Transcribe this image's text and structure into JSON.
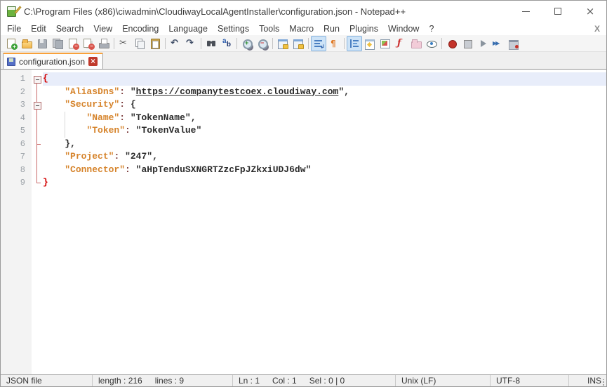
{
  "window": {
    "title": "C:\\Program Files (x86)\\ciwadmin\\CloudiwayLocalAgentInstaller\\configuration.json - Notepad++",
    "app_icon": "notepad-plus-plus-icon",
    "controls": [
      "minimize-icon",
      "maximize-icon",
      "close-icon"
    ]
  },
  "menu": {
    "items": [
      "File",
      "Edit",
      "Search",
      "View",
      "Encoding",
      "Language",
      "Settings",
      "Tools",
      "Macro",
      "Run",
      "Plugins",
      "Window",
      "?"
    ],
    "close_document_x": "X"
  },
  "toolbar": {
    "items": [
      {
        "name": "new-file"
      },
      {
        "name": "open"
      },
      {
        "name": "save"
      },
      {
        "name": "save-all"
      },
      {
        "name": "close"
      },
      {
        "name": "close-all"
      },
      {
        "name": "print"
      },
      {
        "sep": true
      },
      {
        "name": "cut"
      },
      {
        "name": "copy"
      },
      {
        "name": "paste"
      },
      {
        "sep": true
      },
      {
        "name": "undo"
      },
      {
        "name": "redo"
      },
      {
        "sep": true
      },
      {
        "name": "find"
      },
      {
        "name": "replace"
      },
      {
        "sep": true
      },
      {
        "name": "zoom-in"
      },
      {
        "name": "zoom-out"
      },
      {
        "sep": true
      },
      {
        "name": "sync-v"
      },
      {
        "name": "sync-h"
      },
      {
        "sep": true
      },
      {
        "name": "word-wrap",
        "pressed": true
      },
      {
        "name": "show-all-chars"
      },
      {
        "sep": true
      },
      {
        "name": "indent-guide",
        "pressed": true
      },
      {
        "name": "doc-switcher"
      },
      {
        "name": "doc-map"
      },
      {
        "name": "function-list"
      },
      {
        "name": "folder-as-workspace"
      },
      {
        "name": "monitoring"
      },
      {
        "sep": true
      },
      {
        "name": "macro-record"
      },
      {
        "name": "macro-stop"
      },
      {
        "name": "macro-play"
      },
      {
        "name": "macro-run-multiple"
      },
      {
        "name": "macro-save"
      }
    ]
  },
  "tabs": [
    {
      "label": "configuration.json",
      "saved": true
    }
  ],
  "editor": {
    "lines": [
      {
        "n": 1,
        "fold": "boxfirst",
        "cur": true,
        "toks": [
          [
            "{",
            "brace"
          ]
        ]
      },
      {
        "n": 2,
        "fold": "v",
        "toks": [
          [
            "    ",
            "pln"
          ],
          [
            "\"AliasDns\"",
            "key"
          ],
          [
            ":",
            "op"
          ],
          [
            " ",
            "pln"
          ],
          [
            "\"",
            "str"
          ],
          [
            "https://companytestcoex.cloudiway.com",
            "url"
          ],
          [
            "\"",
            "str"
          ],
          [
            ",",
            "pln"
          ]
        ]
      },
      {
        "n": 3,
        "fold": "box",
        "toks": [
          [
            "    ",
            "pln"
          ],
          [
            "\"Security\"",
            "key"
          ],
          [
            ":",
            "op"
          ],
          [
            " {",
            "pln"
          ]
        ]
      },
      {
        "n": 4,
        "fold": "v",
        "guide": true,
        "toks": [
          [
            "        ",
            "pln"
          ],
          [
            "\"Name\"",
            "key"
          ],
          [
            ":",
            "op"
          ],
          [
            " ",
            "pln"
          ],
          [
            "\"TokenName\"",
            "str"
          ],
          [
            ",",
            "pln"
          ]
        ]
      },
      {
        "n": 5,
        "fold": "v",
        "guide": true,
        "toks": [
          [
            "        ",
            "pln"
          ],
          [
            "\"Token\"",
            "key"
          ],
          [
            ":",
            "op"
          ],
          [
            " ",
            "pln"
          ],
          [
            "\"TokenValue\"",
            "str"
          ]
        ]
      },
      {
        "n": 6,
        "fold": "tee",
        "toks": [
          [
            "    ",
            "pln"
          ],
          [
            "},",
            "pln"
          ]
        ]
      },
      {
        "n": 7,
        "fold": "v",
        "toks": [
          [
            "    ",
            "pln"
          ],
          [
            "\"Project\"",
            "key"
          ],
          [
            ":",
            "op"
          ],
          [
            " ",
            "pln"
          ],
          [
            "\"247\"",
            "str"
          ],
          [
            ",",
            "pln"
          ]
        ]
      },
      {
        "n": 8,
        "fold": "v",
        "toks": [
          [
            "    ",
            "pln"
          ],
          [
            "\"Connector\"",
            "key"
          ],
          [
            ":",
            "op"
          ],
          [
            " ",
            "pln"
          ],
          [
            "\"aHpTenduSXNGRTZzcFpJZkxiUDJ6dw\"",
            "str"
          ]
        ]
      },
      {
        "n": 9,
        "fold": "corner",
        "toks": [
          [
            "}",
            "brace"
          ]
        ]
      }
    ]
  },
  "status": {
    "doctype": "JSON file",
    "length_text": "length : 216",
    "lines_text": "lines : 9",
    "ln": "Ln : 1",
    "col": "Col : 1",
    "sel": "Sel : 0 | 0",
    "eol": "Unix (LF)",
    "encoding": "UTF-8",
    "mode": "INS"
  },
  "colors": {
    "tab_accent_orange": "#f9a13a",
    "json_key_orange": "#d6842c",
    "brace_match_red": "#d40000",
    "fold_line_red": "#c96a6a",
    "current_line_highlight": "#e8edfa",
    "tab_close_red": "#c0392b",
    "toolbar_pressed_blue": "#cde3f7"
  }
}
